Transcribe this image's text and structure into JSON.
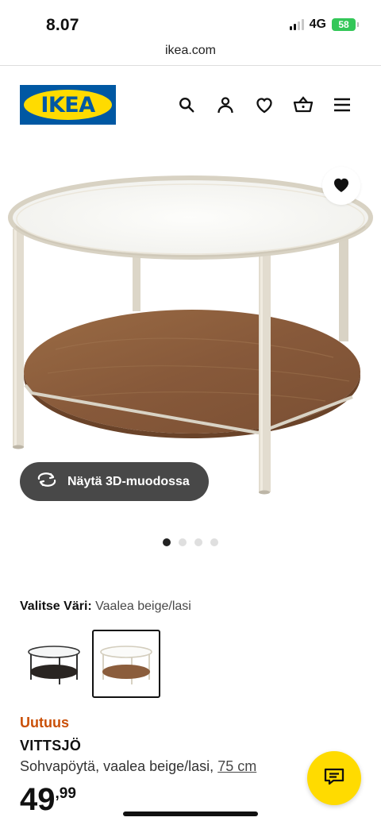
{
  "status_bar": {
    "time": "8.07",
    "network": "4G",
    "battery": "58"
  },
  "browser": {
    "url": "ikea.com"
  },
  "header": {
    "logo_text": "IKEA",
    "brand_colors": {
      "blue": "#0058a3",
      "yellow": "#ffdb00"
    },
    "icons": [
      "search-icon",
      "account-icon",
      "heart-icon",
      "basket-icon",
      "menu-icon"
    ]
  },
  "gallery": {
    "view_3d_label": "Näytä 3D-muodossa",
    "pages": 4,
    "active_page": 1
  },
  "color_selector": {
    "label": "Valitse Väri:",
    "selected": "Vaalea beige/lasi",
    "variants": [
      "black-brown/glass",
      "light beige/glass"
    ],
    "selected_index": 1
  },
  "product": {
    "badge": "Uutuus",
    "badge_color": "#ca5008",
    "name": "VITTSJÖ",
    "description": "Sohvapöytä, vaalea beige/lasi,",
    "size": "75 cm",
    "price_integer": "49",
    "price_decimal": ",99"
  }
}
